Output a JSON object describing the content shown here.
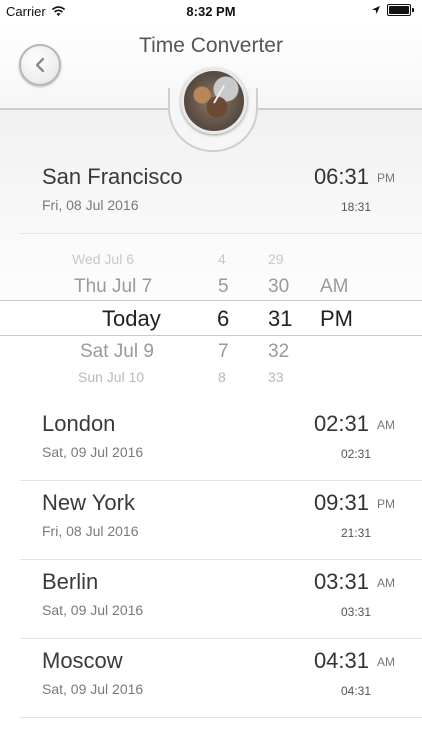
{
  "status_bar": {
    "carrier": "Carrier",
    "time": "8:32 PM"
  },
  "header": {
    "title": "Time Converter",
    "back_icon": "chevron-left-icon",
    "logo_icon": "clock-collage-icon"
  },
  "primary_city": {
    "name": "San Francisco",
    "date": "Fri, 08 Jul 2016",
    "time": "06:31",
    "ampm": "PM",
    "time_24h": "18:31"
  },
  "picker": {
    "days": [
      "Wed Jul 6",
      "Thu Jul 7",
      "Today",
      "Sat Jul 9",
      "Sun Jul 10"
    ],
    "hours": [
      "4",
      "5",
      "6",
      "7",
      "8"
    ],
    "minutes": [
      "29",
      "30",
      "31",
      "32",
      "33"
    ],
    "periods": [
      "AM",
      "PM"
    ],
    "selected": {
      "day": "Today",
      "hour": "6",
      "minute": "31",
      "period": "PM"
    }
  },
  "cities": [
    {
      "name": "London",
      "date": "Sat, 09 Jul 2016",
      "time": "02:31",
      "ampm": "AM",
      "time_24h": "02:31"
    },
    {
      "name": "New York",
      "date": "Fri, 08 Jul 2016",
      "time": "09:31",
      "ampm": "PM",
      "time_24h": "21:31"
    },
    {
      "name": "Berlin",
      "date": "Sat, 09 Jul 2016",
      "time": "03:31",
      "ampm": "AM",
      "time_24h": "03:31"
    },
    {
      "name": "Moscow",
      "date": "Sat, 09 Jul 2016",
      "time": "04:31",
      "ampm": "AM",
      "time_24h": "04:31"
    }
  ]
}
